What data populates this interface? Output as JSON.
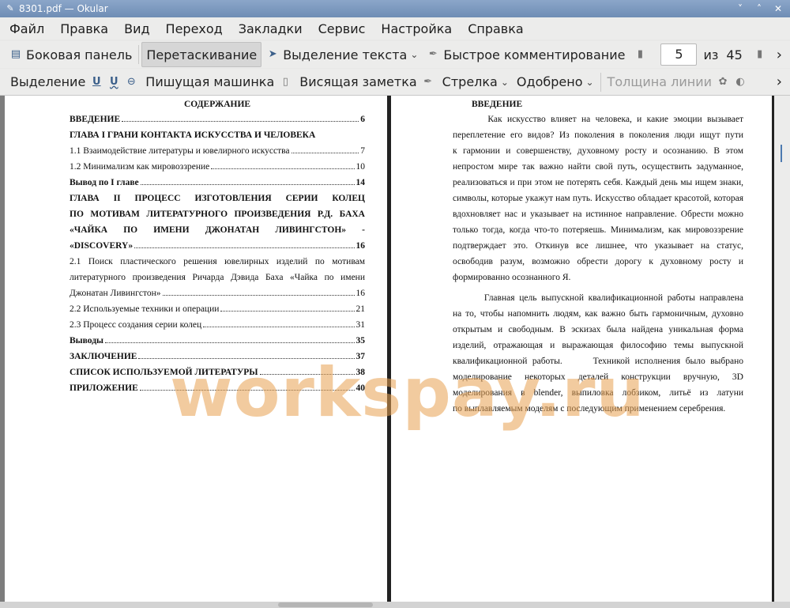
{
  "window": {
    "title": "8301.pdf  — Okular",
    "controls": [
      "˅",
      "˄",
      "✕"
    ]
  },
  "menu": [
    "Файл",
    "Правка",
    "Вид",
    "Переход",
    "Закладки",
    "Сервис",
    "Настройка",
    "Справка"
  ],
  "toolbar1": {
    "sidebar": "Боковая панель",
    "drag": "Перетаскивание",
    "text_select": "Выделение текста",
    "quick_comment": "Быстрое комментирование",
    "page_current": "5",
    "page_of": "из",
    "page_total": "45",
    "more": "›"
  },
  "toolbar2": {
    "selection": "Выделение",
    "typewriter": "Пишущая машинка",
    "sticky_note": "Висящая заметка",
    "arrow": "Стрелка",
    "approved": "Одобрено",
    "line_width": "Толщина линии",
    "more": "›"
  },
  "left_page": {
    "heading": "СОДЕРЖАНИЕ",
    "rows": [
      {
        "text": "ВВЕДЕНИЕ",
        "page": "6",
        "bold": true
      },
      {
        "text": "ГЛАВА I ГРАНИ КОНТАКТА ИСКУССТВА И ЧЕЛОВЕКА",
        "page": "",
        "bold": true
      },
      {
        "text": "1.1 Взаимодействие литературы и ювелирного искусства",
        "page": "7",
        "bold": false
      },
      {
        "text": "1.2 Минимализм как мировоззрение",
        "page": "10",
        "bold": false
      },
      {
        "text": "Вывод по I главе",
        "page": "14",
        "bold": true
      }
    ],
    "chapter2_lines": [
      "ГЛАВА II ПРОЦЕСС ИЗГОТОВЛЕНИЯ СЕРИИ КОЛЕЦ",
      "ПО МОТИВАМ ЛИТЕРАТУРНОГО ПРОИЗВЕДЕНИЯ Р.Д. БАХА",
      "«ЧАЙКА ПО ИМЕНИ ДЖОНАТАН ЛИВИНГСТОН» -"
    ],
    "chapter2_last": {
      "text": "«DISCOVERY»",
      "page": "16"
    },
    "section21_lines": [
      "2.1 Поиск пластического решения ювелирных изделий по мотивам",
      "литературного произведения Ричарда Дэвида Баха «Чайка по имени"
    ],
    "section21_last": {
      "text": "Джонатан Ливингстон»",
      "page": "16"
    },
    "rows2": [
      {
        "text": "2.2 Используемые техники и операции",
        "page": "21",
        "bold": false
      },
      {
        "text": "2.3 Процесс создания серии колец",
        "page": "31",
        "bold": false
      },
      {
        "text": "Выводы",
        "page": "35",
        "bold": true
      },
      {
        "text": "ЗАКЛЮЧЕНИЕ",
        "page": "37",
        "bold": true
      },
      {
        "text": "СПИСОК ИСПОЛЬЗУЕМОЙ ЛИТЕРАТУРЫ",
        "page": "38",
        "bold": true
      },
      {
        "text": "ПРИЛОЖЕНИЕ",
        "page": "40",
        "bold": true
      }
    ]
  },
  "right_page": {
    "heading": "ВВЕДЕНИЕ",
    "para1": [
      "       Как искусство влияет на человека, и какие эмоции вызывает",
      "переплетение его видов? Из поколения в поколения люди ищут пути",
      "к гармонии и совершенству, духовному росту и осознанию. В этом",
      "непростом мире так важно найти свой путь, осуществить задуманное,",
      "реализоваться и при этом не потерять себя. Каждый день мы ищем знаки,",
      "символы, которые укажут нам путь. Искусство обладает красотой, которая",
      "вдохновляет нас и указывает на истинное направление. Обрести можно",
      "только тогда, когда что-то потеряешь. Минимализм, как мировоззрение",
      "подтверждает это. Откинув все лишнее, что указывает на статус,",
      "освободив разум, возможно обрести дорогу к духовному росту и",
      "формированно осознанного Я."
    ],
    "para2": [
      "       Главная цель выпускной квалификационной работы направлена",
      "на то, чтобы напомнить людям, как важно быть гармоничным, духовно",
      "открытым и свободным. В эскизах была найдена уникальная форма",
      "изделий, отражающая и выражающая философию темы выпускной",
      "квалификационной работы.      Техникой исполнения было выбрано",
      "моделирование некоторых деталей конструкции вручную, 3D",
      "моделирования в blender, выпиловка лобзиком, литьё из латуни",
      "по выплавляемым моделям с последующим применением серебрения."
    ]
  },
  "watermark": "workspay.ru"
}
